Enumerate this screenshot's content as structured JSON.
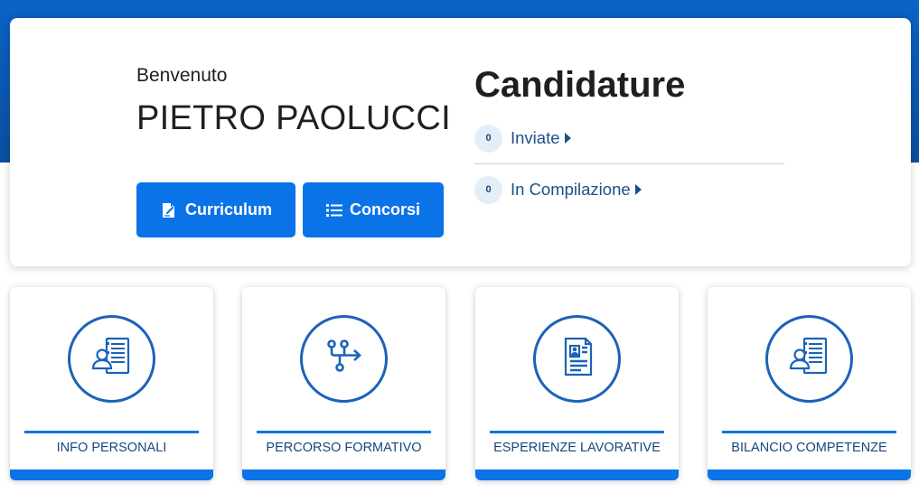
{
  "header": {
    "welcome": "Benvenuto",
    "user_name": "PIETRO PAOLUCCI"
  },
  "buttons": {
    "curriculum": "Curriculum",
    "concorsi": "Concorsi"
  },
  "candidature": {
    "title": "Candidature",
    "items": [
      {
        "count": "0",
        "label": "Inviate"
      },
      {
        "count": "0",
        "label": "In Compilazione"
      }
    ]
  },
  "tiles": [
    {
      "label": "INFO PERSONALI",
      "icon": "user-document-icon"
    },
    {
      "label": "PERCORSO FORMATIVO",
      "icon": "path-arrow-icon"
    },
    {
      "label": "ESPERIENZE LAVORATIVE",
      "icon": "resume-document-icon"
    },
    {
      "label": "BILANCIO COMPETENZE",
      "icon": "user-document-icon"
    }
  ],
  "colors": {
    "primary": "#0b73e8",
    "header_band": "#0a63c7",
    "icon_stroke": "#1b63b7",
    "link_text": "#1d4f88"
  }
}
